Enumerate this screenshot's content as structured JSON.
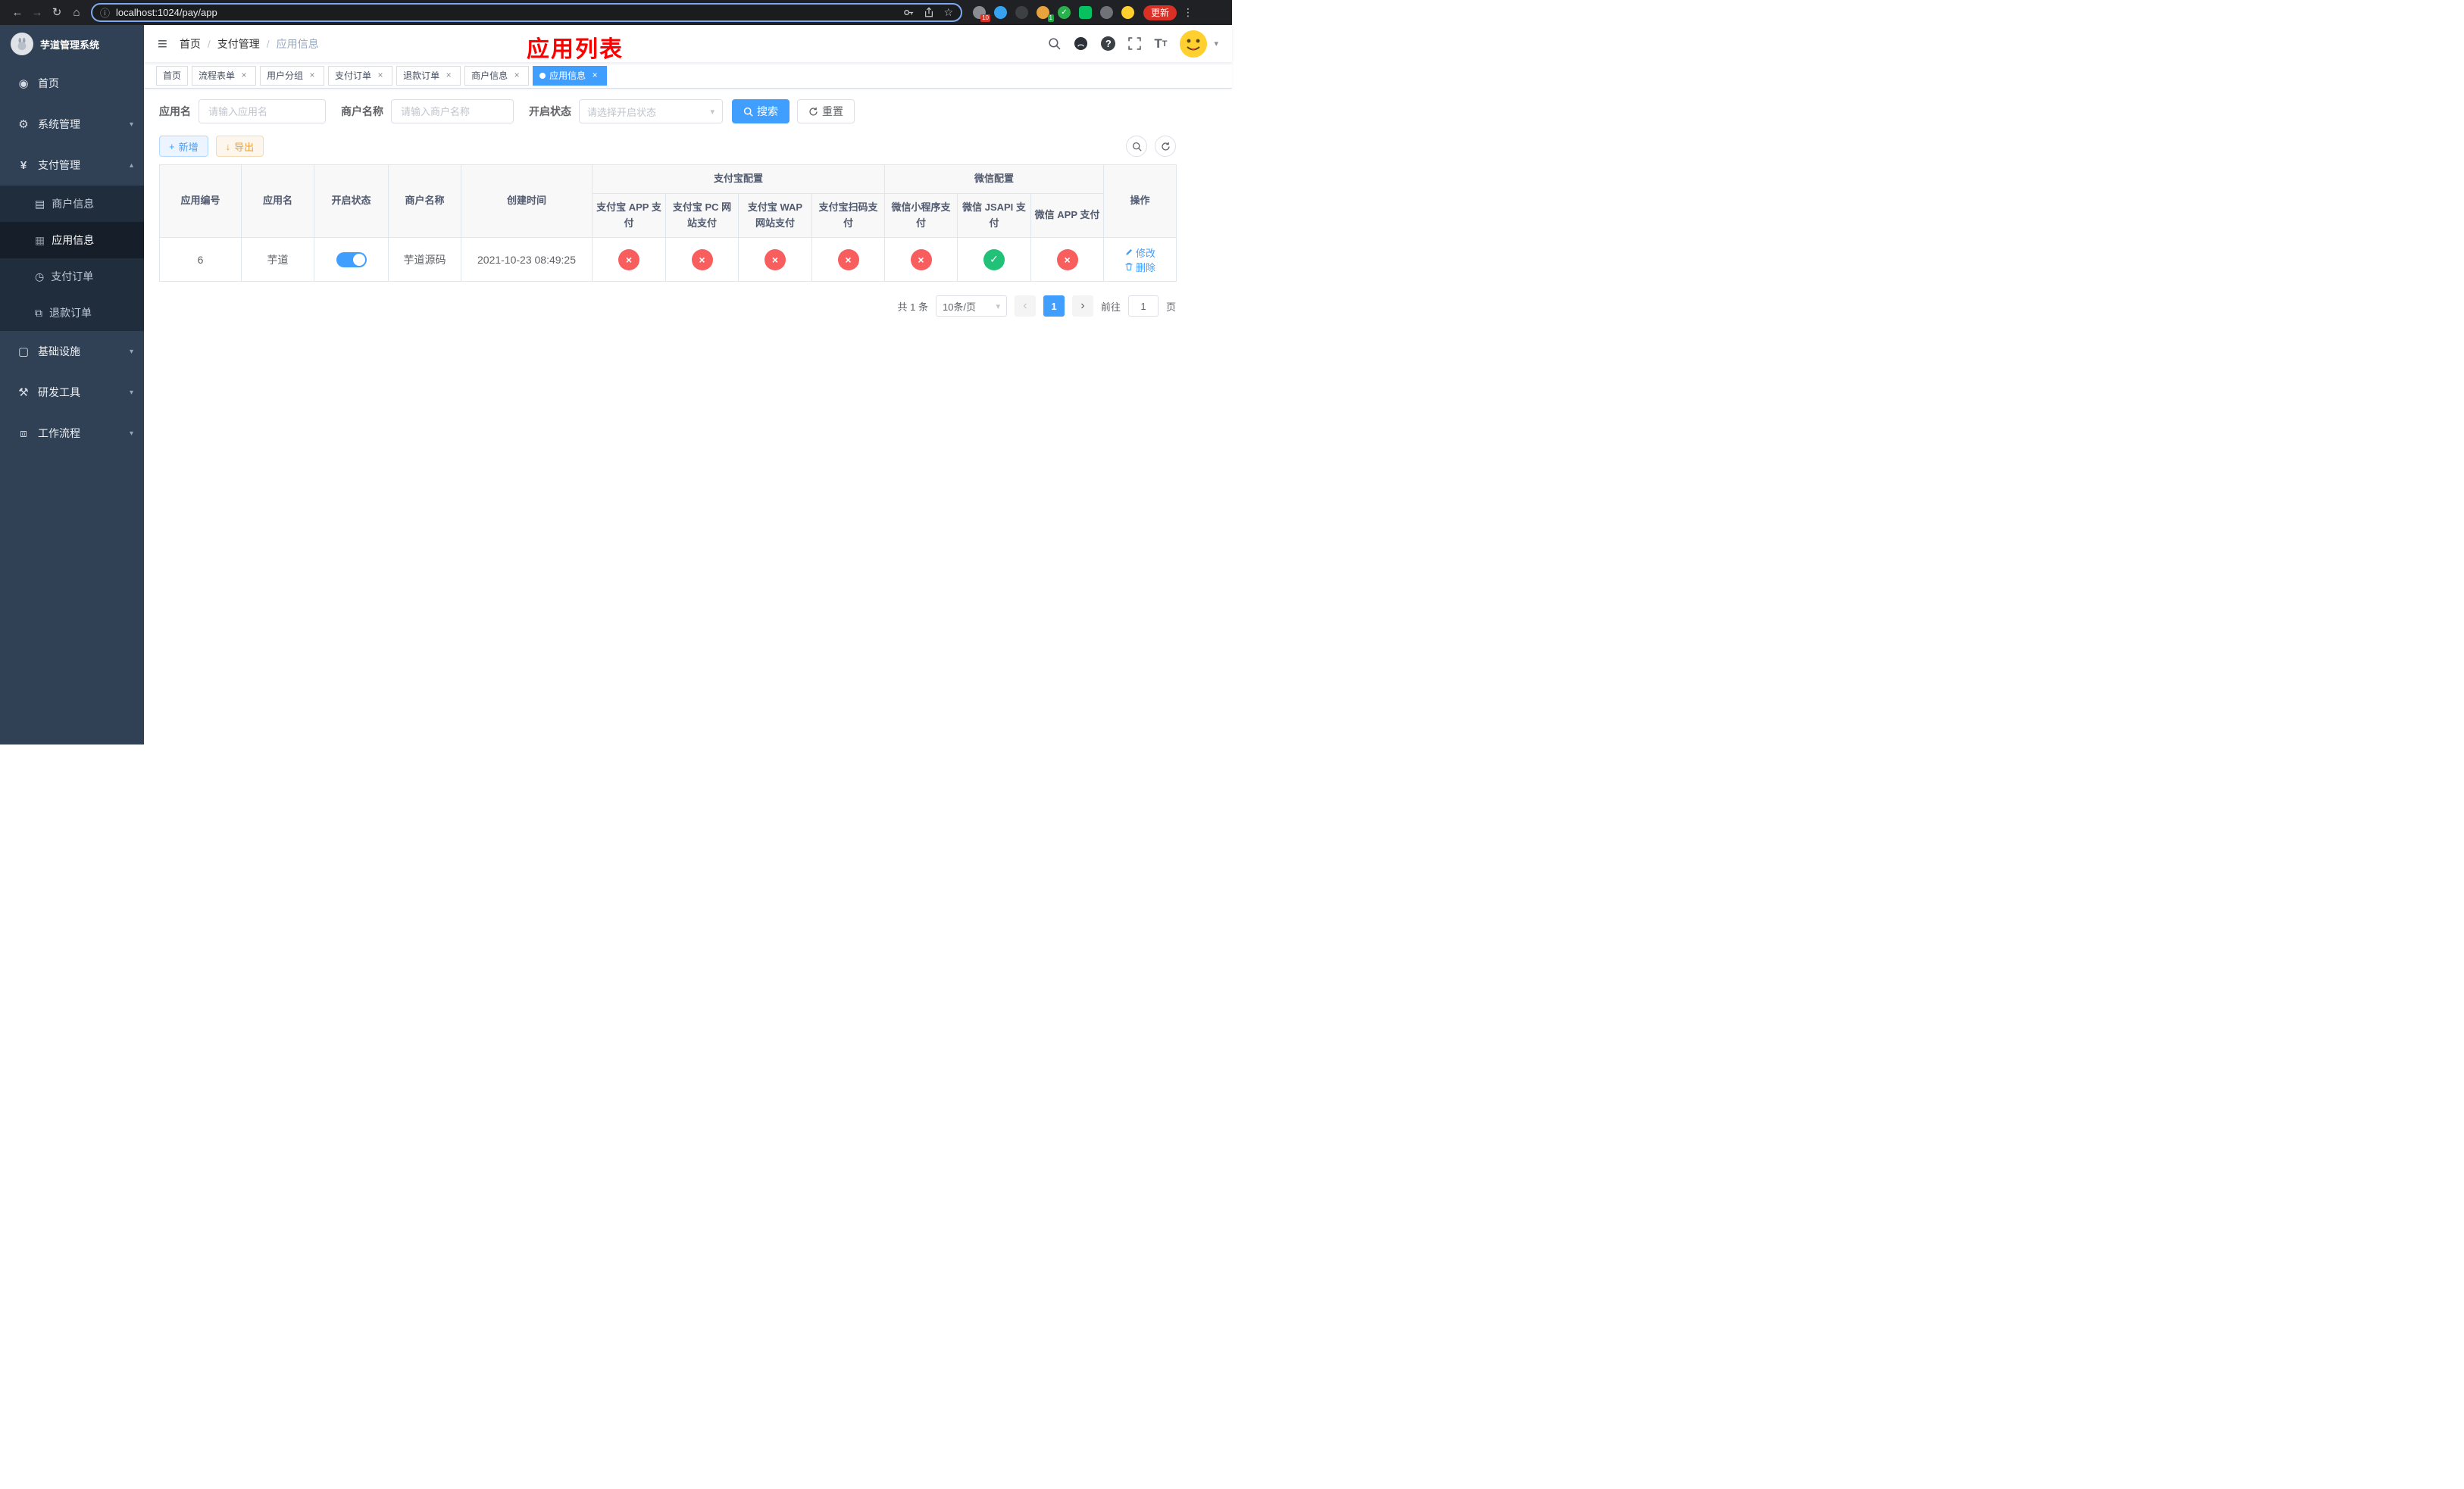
{
  "colors": {
    "accent": "#409eff",
    "success": "#22c178",
    "fail": "#f95e5e",
    "annotation": "#ff0000",
    "update": "#d93025",
    "warning": "#e6a23c"
  },
  "icons": {
    "back": "←",
    "forward": "→",
    "reload": "↻",
    "home": "⌂",
    "info": "ⓘ",
    "star": "☆",
    "menu_dots": "⋮",
    "hamburger": "≡",
    "breadcrumb_sep": "/",
    "question": "?",
    "chevron_down": "▾",
    "chevron_up": "▴",
    "caret_down": "▾",
    "dashboard": "◉",
    "gear": "⚙",
    "yen": "¥",
    "card": "▤",
    "grid": "▦",
    "order": "◷",
    "refund": "⧉",
    "infra": "▢",
    "tools": "⚒",
    "flow": "⧈",
    "plus": "+",
    "download": "↓",
    "close": "×",
    "check": "✓",
    "cross": "×",
    "prev": "‹",
    "next": "›"
  },
  "browser": {
    "url": "localhost:1024/pay/app",
    "update_label": "更新",
    "ext_badge_puzzle": "10",
    "ext_badge_avatar": "1"
  },
  "sidebar": {
    "title": "芋道管理系统",
    "items": {
      "home": "首页",
      "system": "系统管理",
      "payment": "支付管理",
      "merchant": "商户信息",
      "app": "应用信息",
      "order": "支付订单",
      "refund": "退款订单",
      "infra": "基础设施",
      "devtools": "研发工具",
      "workflow": "工作流程"
    }
  },
  "header": {
    "breadcrumb": [
      "首页",
      "支付管理",
      "应用信息"
    ],
    "annotation": "应用列表"
  },
  "tabs": [
    {
      "label": "首页"
    },
    {
      "label": "流程表单"
    },
    {
      "label": "用户分组"
    },
    {
      "label": "支付订单"
    },
    {
      "label": "退款订单"
    },
    {
      "label": "商户信息"
    },
    {
      "label": "应用信息"
    }
  ],
  "filters": {
    "app_name": {
      "label": "应用名",
      "placeholder": "请输入应用名"
    },
    "merchant": {
      "label": "商户名称",
      "placeholder": "请输入商户名称"
    },
    "status": {
      "label": "开启状态",
      "placeholder": "请选择开启状态"
    },
    "search": "搜索",
    "reset": "重置"
  },
  "toolbar": {
    "add": "新增",
    "export": "导出"
  },
  "table": {
    "left_columns": [
      "应用编号",
      "应用名",
      "开启状态",
      "商户名称",
      "创建时间"
    ],
    "alipay_group": "支付宝配置",
    "alipay_columns": [
      "支付宝 APP 支付",
      "支付宝 PC 网站支付",
      "支付宝 WAP 网站支付",
      "支付宝扫码支付"
    ],
    "wechat_group": "微信配置",
    "wechat_columns": [
      "微信小程序支付",
      "微信 JSAPI 支付",
      "微信 APP 支付"
    ],
    "actions_column": "操作",
    "row": {
      "id": "6",
      "name": "芋道",
      "enabled": true,
      "merchant": "芋道源码",
      "created_at": "2021-10-23 08:49:25",
      "channels": [
        "fail",
        "fail",
        "fail",
        "fail",
        "fail",
        "success",
        "fail"
      ],
      "edit": "修改",
      "delete": "删除"
    }
  },
  "pagination": {
    "total": "共 1 条",
    "page_size": "10条/页",
    "page": "1",
    "goto": "前往",
    "goto_value": "1",
    "unit": "页"
  }
}
